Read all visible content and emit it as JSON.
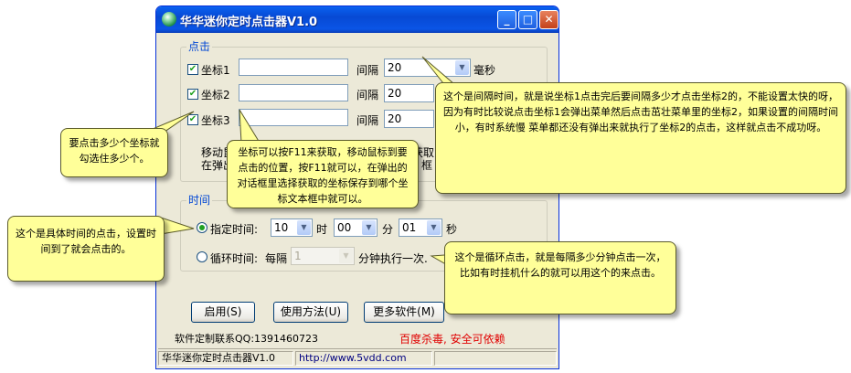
{
  "window": {
    "title": "华华迷你定时点击器V1.0",
    "controls": {
      "minimize": "_",
      "maximize": "□",
      "close": "✕"
    }
  },
  "click_group": {
    "legend": "点击",
    "rows": [
      {
        "label": "坐标1",
        "checked": true,
        "coord_value": "",
        "interval_label": "间隔",
        "interval_value": "20",
        "unit": "毫秒"
      },
      {
        "label": "坐标2",
        "checked": true,
        "coord_value": "",
        "interval_label": "间隔",
        "interval_value": "20"
      },
      {
        "label": "坐标3",
        "checked": true,
        "coord_value": "",
        "interval_label": "间隔",
        "interval_value": "20"
      }
    ],
    "hint_line1_start": "移动鼠",
    "hint_line1_end": "获取",
    "hint_line2_start": "在弹出",
    "hint_line2_end": "框"
  },
  "time_group": {
    "legend": "时间",
    "fixed": {
      "label": "指定时间:",
      "selected": true,
      "hour": "10",
      "hour_unit": "时",
      "minute": "00",
      "minute_unit": "分",
      "second": "01",
      "second_unit": "秒"
    },
    "loop": {
      "label": "循环时间:",
      "selected": false,
      "every_label": "每隔",
      "every_value": "1",
      "suffix": "分钟执行一次."
    }
  },
  "buttons": {
    "start": "启用(S)",
    "usage": "使用方法(U)",
    "more": "更多软件(M)"
  },
  "contact": "软件定制联系QQ:1391460723",
  "safety": "百度杀毒, 安全可依赖",
  "statusbar": {
    "name": "华华迷你定时点击器V1.0",
    "url": "http://www.5vdd.com"
  },
  "tooltips": {
    "interval": "这个是间隔时间，就是说坐标1点击完后要间隔多少才点击坐标2的，不能设置太快的呀，因为有时比较说点击坐标1会弹出菜单然后点击茁壮菜单里的坐标2，如果设置的间隔时间小，有时系统慢 菜单都还没有弹出来就执行了坐标2的点击，这样就点击不成功呀。",
    "checkbox": "要点击多少个坐标就勾选住多少个。",
    "coord": "坐标可以按F11来获取，移动鼠标到要点击的位置，按F11就可以，在弹出的对话框里选择获取的坐标保存到哪个坐标文本框中就可以。",
    "fixed_time": "这个是具体时间的点击，设置时间到了就会点击的。",
    "loop": "这个是循环点击，就是每隔多少分钟点击一次，比如有时挂机什么的就可以用这个的来点击。"
  },
  "colors": {
    "titlebar": "#0a55e6",
    "tooltip_bg": "#ffff99",
    "safety_text": "#e00000",
    "legend_text": "#0046d5",
    "check_green": "#21a121"
  }
}
